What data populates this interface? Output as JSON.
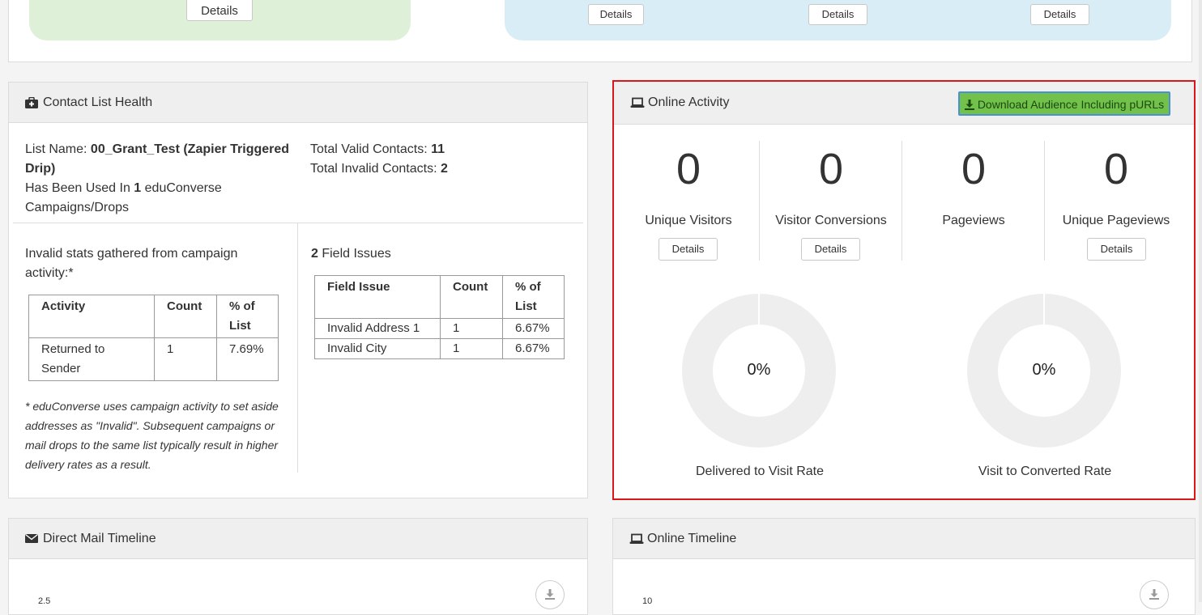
{
  "top_cards": {
    "green_details": "Details",
    "blue_details_1": "Details",
    "blue_details_2": "Details",
    "blue_details_3": "Details"
  },
  "contact_health": {
    "title": "Contact List Health",
    "list_name_label": "List Name: ",
    "list_name_value": "00_Grant_Test (Zapier Triggered Drip)",
    "used_in_prefix": "Has Been Used In ",
    "used_in_count": "1",
    "used_in_suffix": " eduConverse Campaigns/Drops",
    "valid_label": "Total Valid Contacts: ",
    "valid_value": "11",
    "invalid_label": "Total Invalid Contacts: ",
    "invalid_value": "2",
    "invalid_intro": "Invalid stats gathered from campaign activity:*",
    "activity_table": {
      "headers": [
        "Activity",
        "Count",
        "% of List"
      ],
      "rows": [
        [
          "Returned to Sender",
          "1",
          "7.69%"
        ]
      ]
    },
    "footnote": "* eduConverse uses campaign activity to set aside addresses as \"Invalid\". Subsequent campaigns or mail drops to the same list typically result in higher delivery rates as a result.",
    "field_issues_count": "2",
    "field_issues_label": " Field Issues",
    "field_table": {
      "headers": [
        "Field Issue",
        "Count",
        "% of List"
      ],
      "rows": [
        [
          "Invalid Address 1",
          "1",
          "6.67%"
        ],
        [
          "Invalid City",
          "1",
          "6.67%"
        ]
      ]
    }
  },
  "online_activity": {
    "title": "Online Activity",
    "download_button": "Download Audience Including pURLs",
    "metrics": [
      {
        "value": "0",
        "label": "Unique Visitors",
        "button": "Details"
      },
      {
        "value": "0",
        "label": "Visitor Conversions",
        "button": "Details"
      },
      {
        "value": "0",
        "label": "Pageviews"
      },
      {
        "value": "0",
        "label": "Unique Pageviews",
        "button": "Details"
      }
    ],
    "donuts": [
      {
        "value": "0%",
        "fraction": 0,
        "label": "Delivered to Visit Rate"
      },
      {
        "value": "0%",
        "fraction": 0,
        "label": "Visit to Converted Rate"
      }
    ]
  },
  "direct_mail_timeline": {
    "title": "Direct Mail Timeline",
    "tick_partial": "2.5"
  },
  "online_timeline": {
    "title": "Online Timeline",
    "tick_partial": "10"
  },
  "colors": {
    "highlight_border": "#d9161c",
    "download_bg": "#72c14a",
    "green_card": "#dff0d8",
    "blue_card": "#d9edf7",
    "donut_track": "#eeeeee"
  }
}
